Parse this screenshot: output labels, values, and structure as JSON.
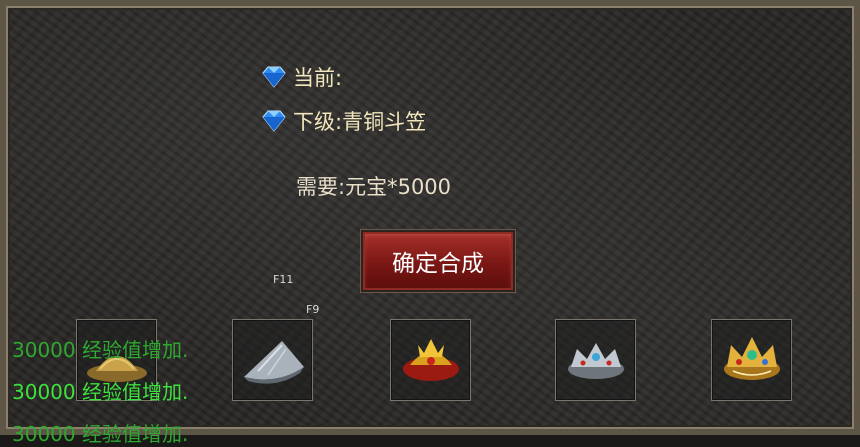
{
  "upgrade": {
    "current_label": "当前:",
    "next_label": "下级:",
    "next_item": "青铜斗笠",
    "require_label": "需要:",
    "require_value": "元宝*5000",
    "confirm_button": "确定合成"
  },
  "hotkeys": [
    "F11",
    "F9"
  ],
  "slots": [
    {
      "icon": "straw-hat-icon"
    },
    {
      "icon": "silver-conical-hat-icon"
    },
    {
      "icon": "golden-helmet-icon"
    },
    {
      "icon": "silver-crown-icon"
    },
    {
      "icon": "jeweled-crown-icon"
    }
  ],
  "messages": [
    {
      "text": "30000 经验值增加.",
      "color": "#2fa82f"
    },
    {
      "text": "30000 经验值增加.",
      "color": "#3de23d"
    },
    {
      "text": "30000 经验值增加.",
      "color": "#2fa82f"
    }
  ],
  "colors": {
    "label": "#f2e6bd",
    "confirm_bg": "#8b1e19",
    "exp_text": "#3de23d"
  }
}
